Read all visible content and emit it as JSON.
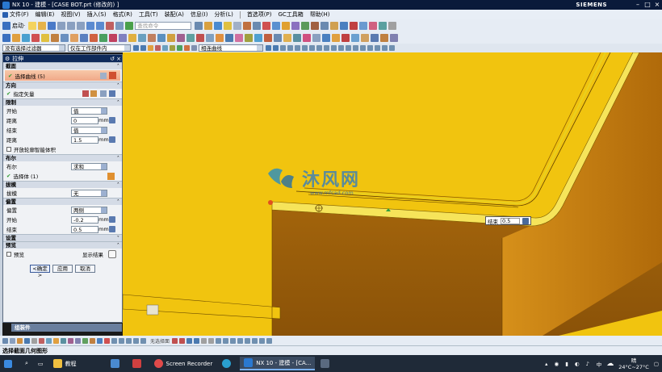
{
  "window": {
    "title": "NX 10 - 建模 - [CASE BOT.prt  (修改的) ]",
    "brand": "SIEMENS"
  },
  "menu": [
    "文件(F)",
    "编辑(E)",
    "视图(V)",
    "插入(S)",
    "格式(R)",
    "工具(T)",
    "装配(A)",
    "信息(I)",
    "分析(L)",
    "首选项(P)",
    "GC工具箱",
    "帮助(H)"
  ],
  "toolbar": {
    "start_label": "启动·",
    "search_placeholder": "查找命令",
    "filter_combo": "没有选择过滤器",
    "scope_combo": "仅在工作部件内",
    "curve_rule_combo": "相连曲线"
  },
  "dialog": {
    "title": "拉伸",
    "sections": {
      "section": "截面",
      "direction": "方向",
      "limits": "限制",
      "boolean": "布尔",
      "draft": "拔模",
      "offset": "偏置",
      "settings": "设置",
      "preview": "预览"
    },
    "select_curve": "选择曲线 (5)",
    "specify_vector": "指定矢量",
    "start_label": "开始",
    "start_value": "值",
    "distance_label": "距离",
    "start_distance": "0",
    "end_label": "结束",
    "end_value": "值",
    "end_distance": "1.5",
    "unit": "mm",
    "open_profile": "开放轮廓智能体积",
    "boolean_label": "布尔",
    "boolean_value": "求和",
    "select_body": "选择体 (1)",
    "draft_label": "拔模",
    "draft_value": "无",
    "offset_label": "偏置",
    "offset_value": "两侧",
    "offset_start_label": "开始",
    "offset_start": "-0.2",
    "offset_end_label": "结束",
    "offset_end": "0.5",
    "preview_label": "预览",
    "show_result": "显示结果",
    "ok": "<确定>",
    "apply": "应用",
    "cancel": "取消"
  },
  "assembly_nav": "组装件",
  "floating_field": {
    "label": "结束",
    "value": "0.5"
  },
  "watermark": {
    "main": "沐风网",
    "sub": "www.mfcad.com"
  },
  "bottom_toolbar": {
    "snap_label": "无选择面"
  },
  "status_text": "选择截面几何图形",
  "taskbar": {
    "folder": "教程",
    "recorder": "Screen Recorder",
    "nx_app": "NX 10 - 建模 - [CA...",
    "weather": "24°C~27°C",
    "time": "晴",
    "ime": "中"
  },
  "colors": {
    "model_yellow": "#f1c40f",
    "titlebar": "#0a1a3a",
    "dialog_header": "#0e2a5a",
    "taskbar": "#1f2a38"
  }
}
